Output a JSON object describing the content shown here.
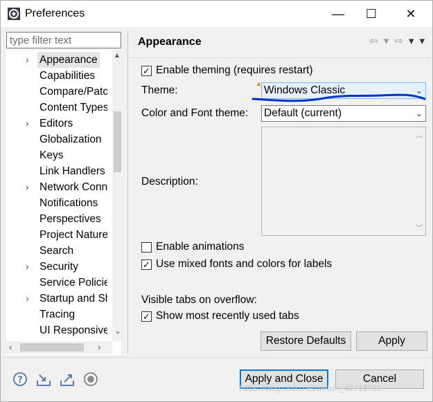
{
  "window": {
    "title": "Preferences",
    "minimize_glyph": "—",
    "maximize_glyph": "☐",
    "close_glyph": "✕"
  },
  "filter": {
    "placeholder": "type filter text",
    "value": ""
  },
  "tree": {
    "items": [
      {
        "label": "Appearance",
        "expandable": true,
        "selected": true
      },
      {
        "label": "Capabilities",
        "expandable": false
      },
      {
        "label": "Compare/Patch",
        "expandable": false
      },
      {
        "label": "Content Types",
        "expandable": false
      },
      {
        "label": "Editors",
        "expandable": true
      },
      {
        "label": "Globalization",
        "expandable": false
      },
      {
        "label": "Keys",
        "expandable": false
      },
      {
        "label": "Link Handlers",
        "expandable": false
      },
      {
        "label": "Network Connections",
        "expandable": true
      },
      {
        "label": "Notifications",
        "expandable": false
      },
      {
        "label": "Perspectives",
        "expandable": false
      },
      {
        "label": "Project Natures",
        "expandable": false
      },
      {
        "label": "Search",
        "expandable": false
      },
      {
        "label": "Security",
        "expandable": true
      },
      {
        "label": "Service Policies",
        "expandable": false
      },
      {
        "label": "Startup and Shutdown",
        "expandable": true
      },
      {
        "label": "Tracing",
        "expandable": false
      },
      {
        "label": "UI Responsiveness",
        "expandable": false
      }
    ],
    "chevron_glyph": "›"
  },
  "page": {
    "title": "Appearance",
    "nav_back": "⇦",
    "nav_forward": "⇨",
    "nav_menu": "▾"
  },
  "theming": {
    "enable_theming_label": "Enable theming (requires restart)",
    "enable_theming_checked": true,
    "theme_label": "Theme:",
    "theme_value": "Windows Classic",
    "color_font_label": "Color and Font theme:",
    "color_font_value": "Default (current)",
    "description_label": "Description:",
    "enable_animations_label": "Enable animations",
    "enable_animations_checked": false,
    "mixed_fonts_label": "Use mixed fonts and colors for labels",
    "mixed_fonts_checked": true,
    "visible_tabs_label": "Visible tabs on overflow:",
    "show_mru_label": "Show most recently used tabs",
    "show_mru_checked": true
  },
  "buttons": {
    "restore_defaults": "Restore Defaults",
    "apply": "Apply",
    "apply_and_close": "Apply and Close",
    "cancel": "Cancel"
  },
  "icons": {
    "help": "help-icon",
    "import": "import-icon",
    "export": "export-icon",
    "record": "record-icon"
  },
  "colors": {
    "annotation": "#0033cc",
    "focus_border": "#0078d7",
    "active_combo": "#e5f1fb"
  },
  "watermark": "https://blog.csdn.net/weixin_42718701"
}
